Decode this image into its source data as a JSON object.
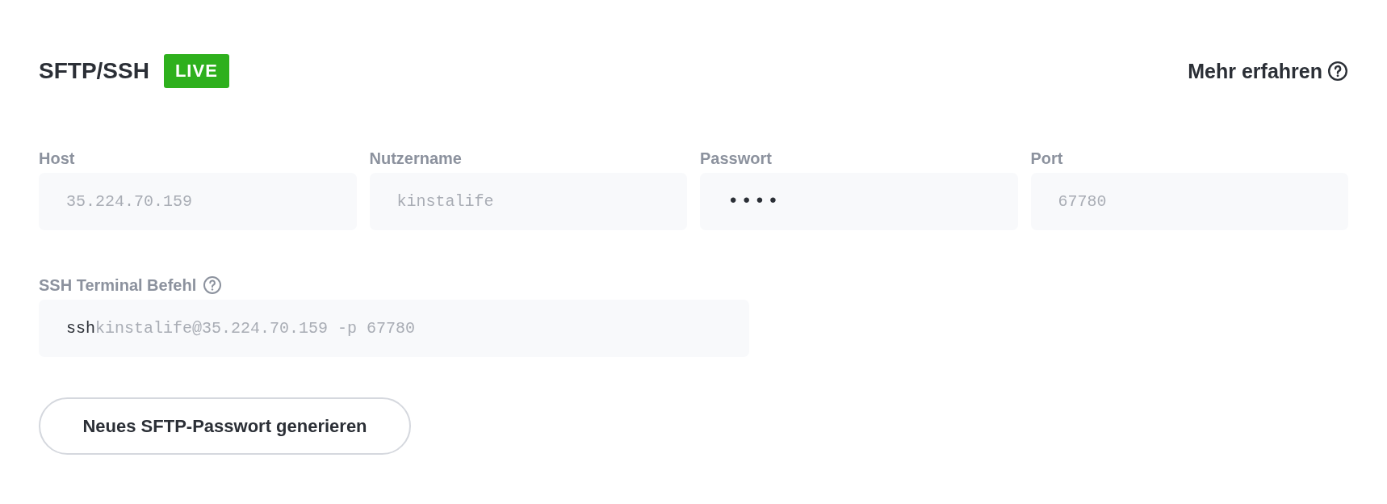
{
  "header": {
    "title": "SFTP/SSH",
    "badge": "LIVE",
    "link": "Mehr erfahren"
  },
  "fields": [
    {
      "label": "Host",
      "value": "35.224.70.159",
      "kind": "plain"
    },
    {
      "label": "Nutzername",
      "value": "kinstalife",
      "kind": "plain"
    },
    {
      "label": "Passwort",
      "value": "••••",
      "kind": "masked"
    },
    {
      "label": "Port",
      "value": "67780",
      "kind": "plain"
    }
  ],
  "command": {
    "label": "SSH Terminal Befehl",
    "prefix": "ssh",
    "value": "kinstalife@35.224.70.159 -p 67780"
  },
  "button": "Neues SFTP-Passwort generieren"
}
